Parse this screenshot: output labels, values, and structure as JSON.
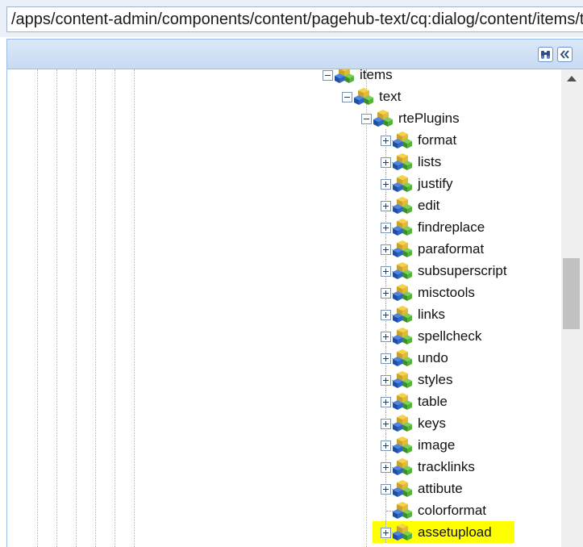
{
  "path_bar": {
    "value": "/apps/content-admin/components/content/pagehub-text/cq:dialog/content/items/tabs/items"
  },
  "panel_tools": {
    "find_icon": "binoculars-icon",
    "collapse_icon": "double-chevron-left-icon"
  },
  "tree": {
    "items": {
      "label": "items",
      "expanded": true
    },
    "text": {
      "label": "text",
      "expanded": true
    },
    "rtePlugins": {
      "label": "rtePlugins",
      "expanded": true
    },
    "children": [
      {
        "label": "format",
        "expandable": true
      },
      {
        "label": "lists",
        "expandable": true
      },
      {
        "label": "justify",
        "expandable": true
      },
      {
        "label": "edit",
        "expandable": true
      },
      {
        "label": "findreplace",
        "expandable": true
      },
      {
        "label": "paraformat",
        "expandable": true
      },
      {
        "label": "subsuperscript",
        "expandable": true
      },
      {
        "label": "misctools",
        "expandable": true
      },
      {
        "label": "links",
        "expandable": true
      },
      {
        "label": "spellcheck",
        "expandable": true
      },
      {
        "label": "undo",
        "expandable": true
      },
      {
        "label": "styles",
        "expandable": true
      },
      {
        "label": "table",
        "expandable": true
      },
      {
        "label": "keys",
        "expandable": true
      },
      {
        "label": "image",
        "expandable": true
      },
      {
        "label": "tracklinks",
        "expandable": true
      },
      {
        "label": "attibute",
        "expandable": true
      },
      {
        "label": "colorformat",
        "expandable": false
      },
      {
        "label": "assetupload",
        "expandable": true,
        "highlighted": true
      }
    ]
  },
  "colors": {
    "highlight": "#ffff00",
    "header": "#c7dbf2",
    "border": "#99bbe8"
  }
}
